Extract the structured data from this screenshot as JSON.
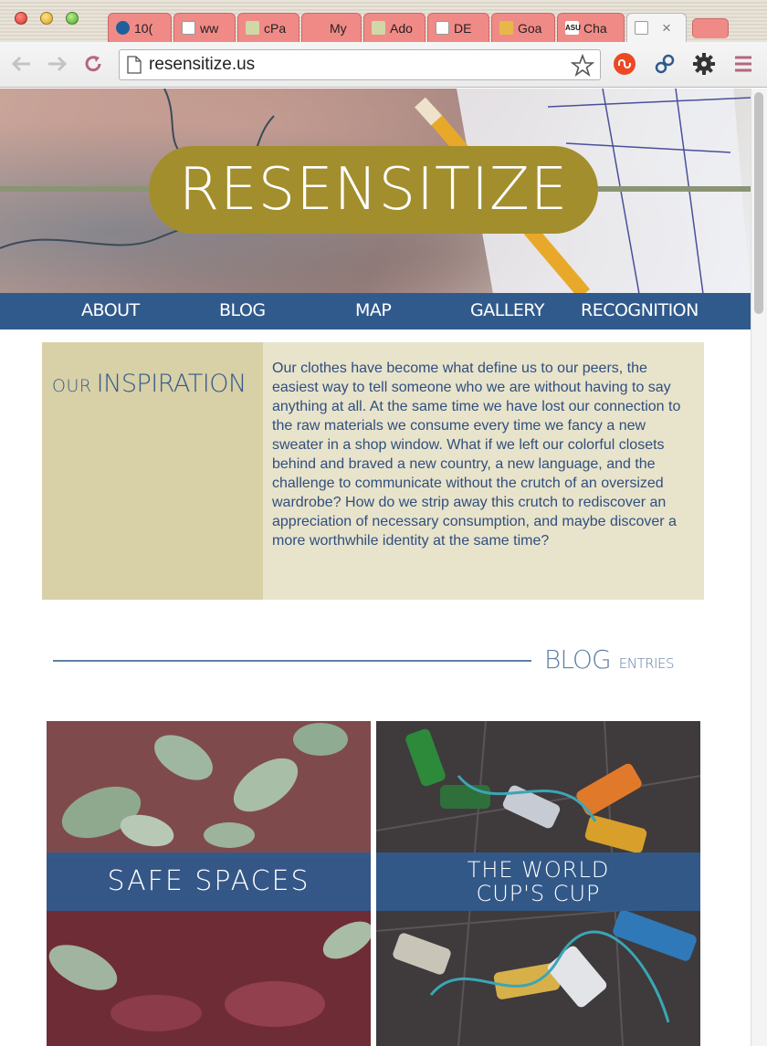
{
  "browser": {
    "tabs": [
      {
        "label": "10(",
        "favicon": "wave-favicon",
        "color": "#1f5f9a"
      },
      {
        "label": "ww",
        "favicon": "page-favicon",
        "color": "#ffffff"
      },
      {
        "label": "cPa",
        "favicon": "tree-favicon",
        "color": "#7a9a3a"
      },
      {
        "label": "My",
        "favicon": "blank-favicon",
        "color": "#f08a86"
      },
      {
        "label": "Ado",
        "favicon": "tree-favicon",
        "color": "#7a9a3a"
      },
      {
        "label": "DE",
        "favicon": "page-favicon",
        "color": "#ffffff"
      },
      {
        "label": "Goa",
        "favicon": "star-favicon",
        "color": "#e6b84a"
      },
      {
        "label": "Cha",
        "favicon": "asu-favicon",
        "color": "#111111"
      }
    ],
    "active_tab": {
      "label": "",
      "close": "×"
    },
    "url": "resensitize.us"
  },
  "site": {
    "logo": "RESENSITIZE",
    "nav": [
      "ABOUT",
      "BLOG",
      "MAP",
      "GALLERY",
      "RECOGNITION"
    ],
    "inspiration": {
      "heading_small": "OUR",
      "heading_big": "INSPIRATION",
      "body": "Our clothes have become what define us to our peers, the easiest way to tell someone who we are without having to say anything at all. At the same time we have lost our connection to the raw materials we consume every time we fancy a new sweater in a shop window. What if we left our colorful closets behind and braved a new country, a new language, and the challenge to communicate without the crutch of an oversized wardrobe? How do we strip away this crutch to rediscover an appreciation of necessary consumption, and maybe discover a more worthwhile identity at the same time?"
    },
    "blog": {
      "heading_big": "BLOG",
      "heading_small": "ENTRIES",
      "entries": [
        {
          "title": "SAFE SPACES"
        },
        {
          "title": "THE WORLD CUP'S CUP"
        }
      ]
    }
  },
  "colors": {
    "nav_blue": "#315a8c",
    "logo_gold": "#a38e2e",
    "panel_beige": "#e8e3cb",
    "panel_side": "#d8d0a6"
  }
}
